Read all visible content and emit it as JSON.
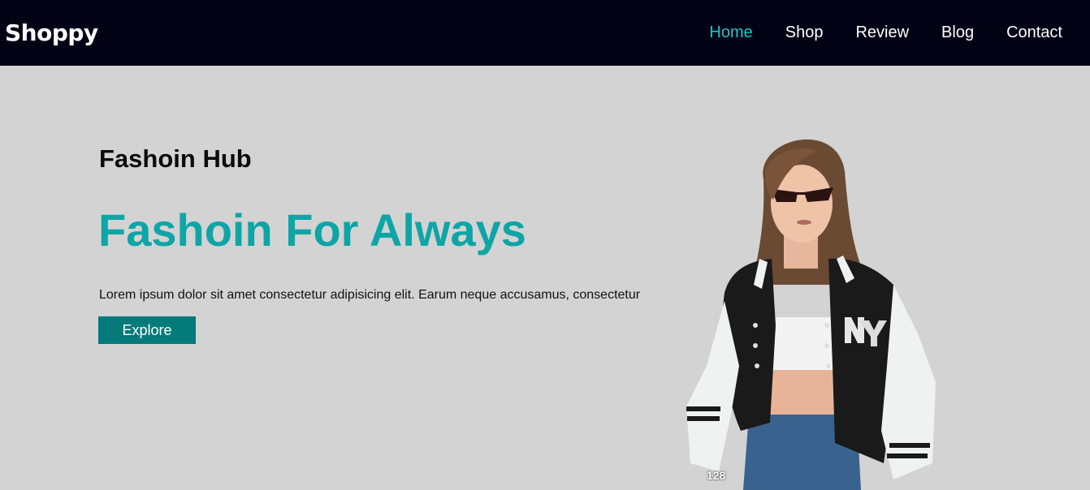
{
  "nav": {
    "brand": "Shoppy",
    "links": [
      {
        "label": "Home",
        "active": true
      },
      {
        "label": "Shop",
        "active": false
      },
      {
        "label": "Review",
        "active": false
      },
      {
        "label": "Blog",
        "active": false
      },
      {
        "label": "Contact",
        "active": false
      }
    ]
  },
  "hero": {
    "subtitle": "Fashoin Hub",
    "headline": "Fashoin For Always",
    "description": "Lorem ipsum dolor sit amet consectetur adipisicing elit. Earum neque accusamus, consectetur",
    "button_label": "Explore",
    "image_label": "128"
  },
  "colors": {
    "navbar_bg": "#020215",
    "accent": "#1fc5c7",
    "headline": "#0ea5a6",
    "button_bg": "#057a7a",
    "hero_bg": "#d3d3d3"
  }
}
